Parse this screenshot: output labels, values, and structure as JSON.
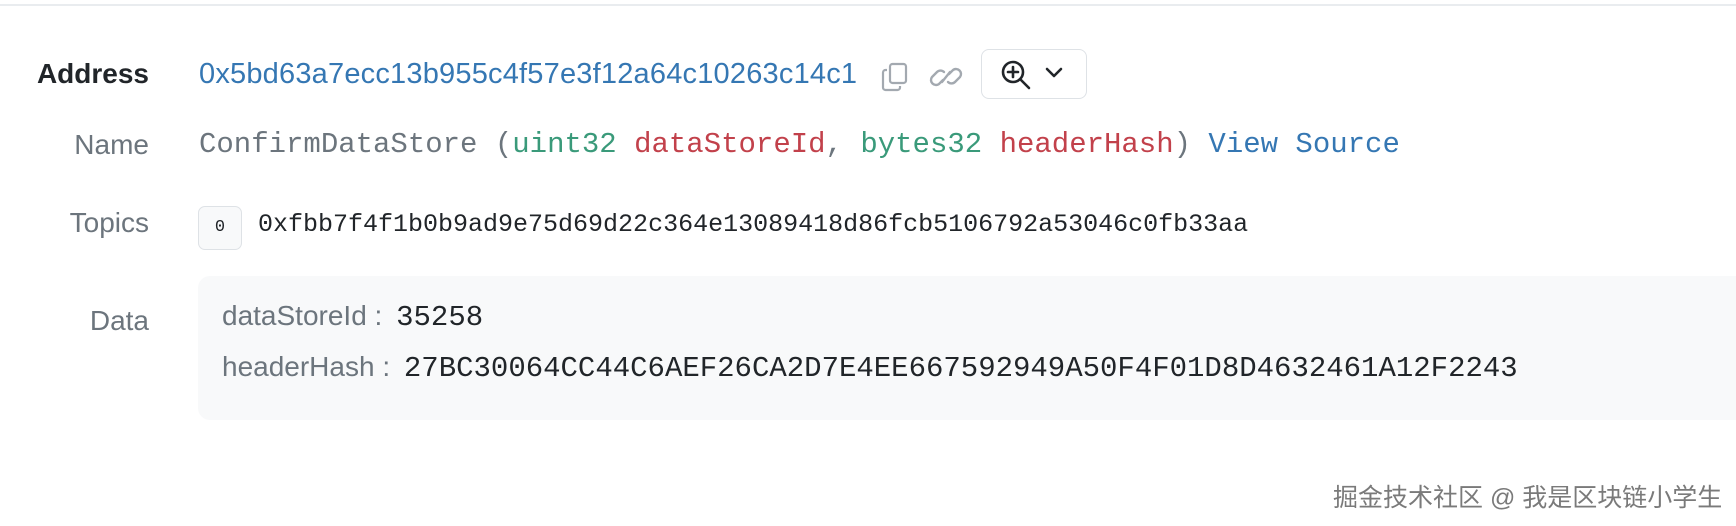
{
  "log": {
    "address": {
      "label": "Address",
      "value": "0x5bd63a7ecc13b955c4f57e3f12a64c10263c14c1"
    },
    "name": {
      "label": "Name",
      "function_name": "ConfirmDataStore",
      "open_paren": " (",
      "params": [
        {
          "type": "uint32",
          "name": "dataStoreId"
        },
        {
          "type": "bytes32",
          "name": "headerHash"
        }
      ],
      "separator": ", ",
      "close_paren": ")",
      "view_source_label": "View Source"
    },
    "topics": {
      "label": "Topics",
      "items": [
        {
          "index": "0",
          "value": "0xfbb7f4f1b0b9ad9e75d69d22c364e13089418d86fcb5106792a53046c0fb33aa"
        }
      ]
    },
    "data": {
      "label": "Data",
      "entries": [
        {
          "key": "dataStoreId",
          "sep": " : ",
          "value": "35258"
        },
        {
          "key": "headerHash",
          "sep": " : ",
          "value": "27BC30064CC44C6AEF26CA2D7E4EE667592949A50F4F01D8D4632461A12F2243"
        }
      ]
    }
  },
  "icons": {
    "copy": "copy-icon",
    "link": "link-icon",
    "zoom": "zoom-in-icon",
    "chevron": "chevron-down-icon"
  },
  "watermark": "掘金技术社区 @ 我是区块链小学生",
  "colors": {
    "link": "#3577b3",
    "param_type": "#3a9a7a",
    "param_name": "#c2414b",
    "muted": "#6c757d"
  }
}
